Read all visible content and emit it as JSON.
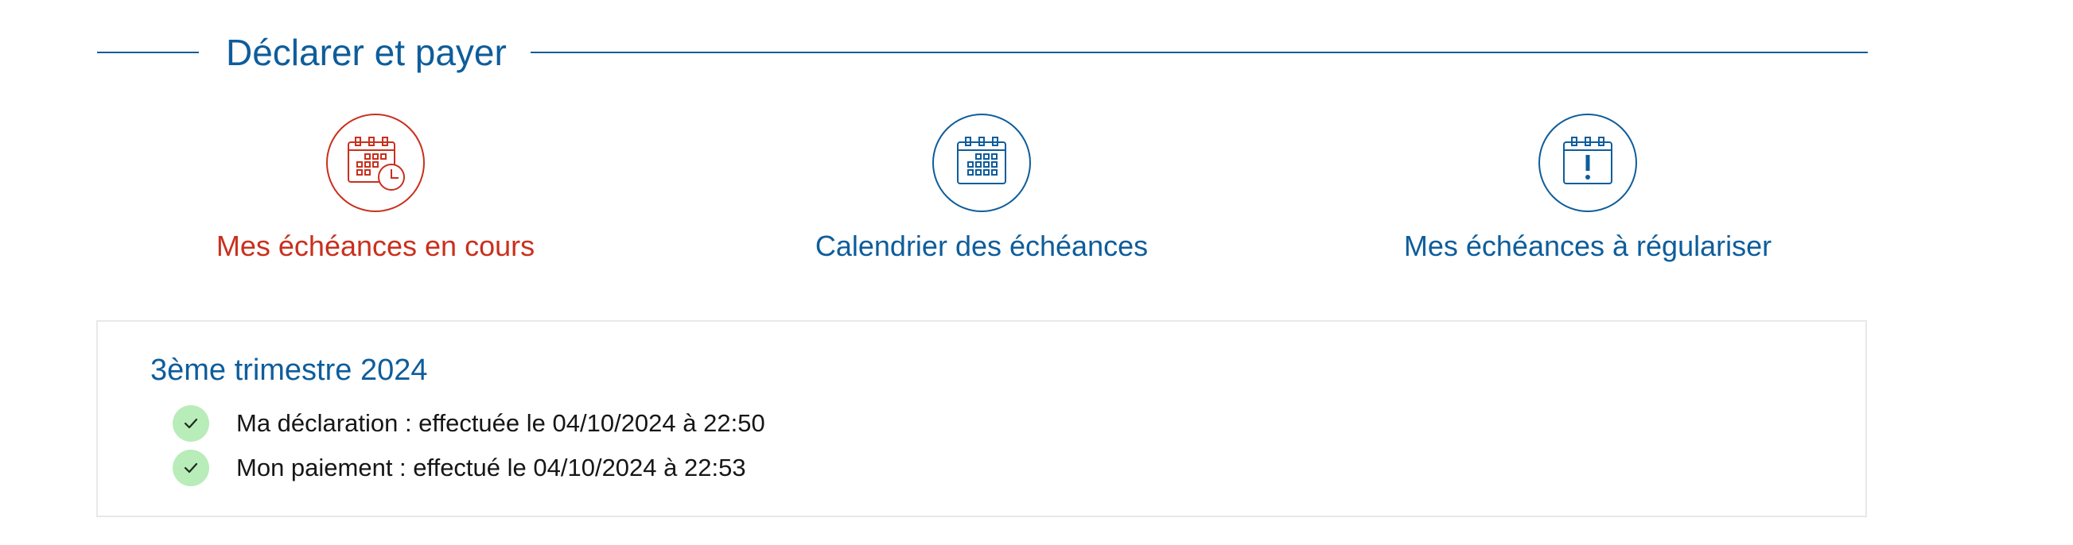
{
  "section": {
    "title": "Déclarer et payer"
  },
  "nav": {
    "items": [
      {
        "label": "Mes échéances en cours",
        "icon": "calendar-clock-icon",
        "active": true
      },
      {
        "label": "Calendrier des échéances",
        "icon": "calendar-icon",
        "active": false
      },
      {
        "label": "Mes échéances à régulariser",
        "icon": "calendar-alert-icon",
        "active": false
      }
    ]
  },
  "quarter": {
    "title": "3ème trimestre 2024",
    "statuses": [
      {
        "text": "Ma déclaration : effectuée le 04/10/2024 à 22:50",
        "icon": "check-icon"
      },
      {
        "text": "Mon paiement : effectué le 04/10/2024 à 22:53",
        "icon": "check-icon"
      }
    ]
  },
  "colors": {
    "primary": "#0e5d9b",
    "active": "#c9301d",
    "success_bg": "#b8ecb9",
    "card_border": "#e8e8e8"
  }
}
